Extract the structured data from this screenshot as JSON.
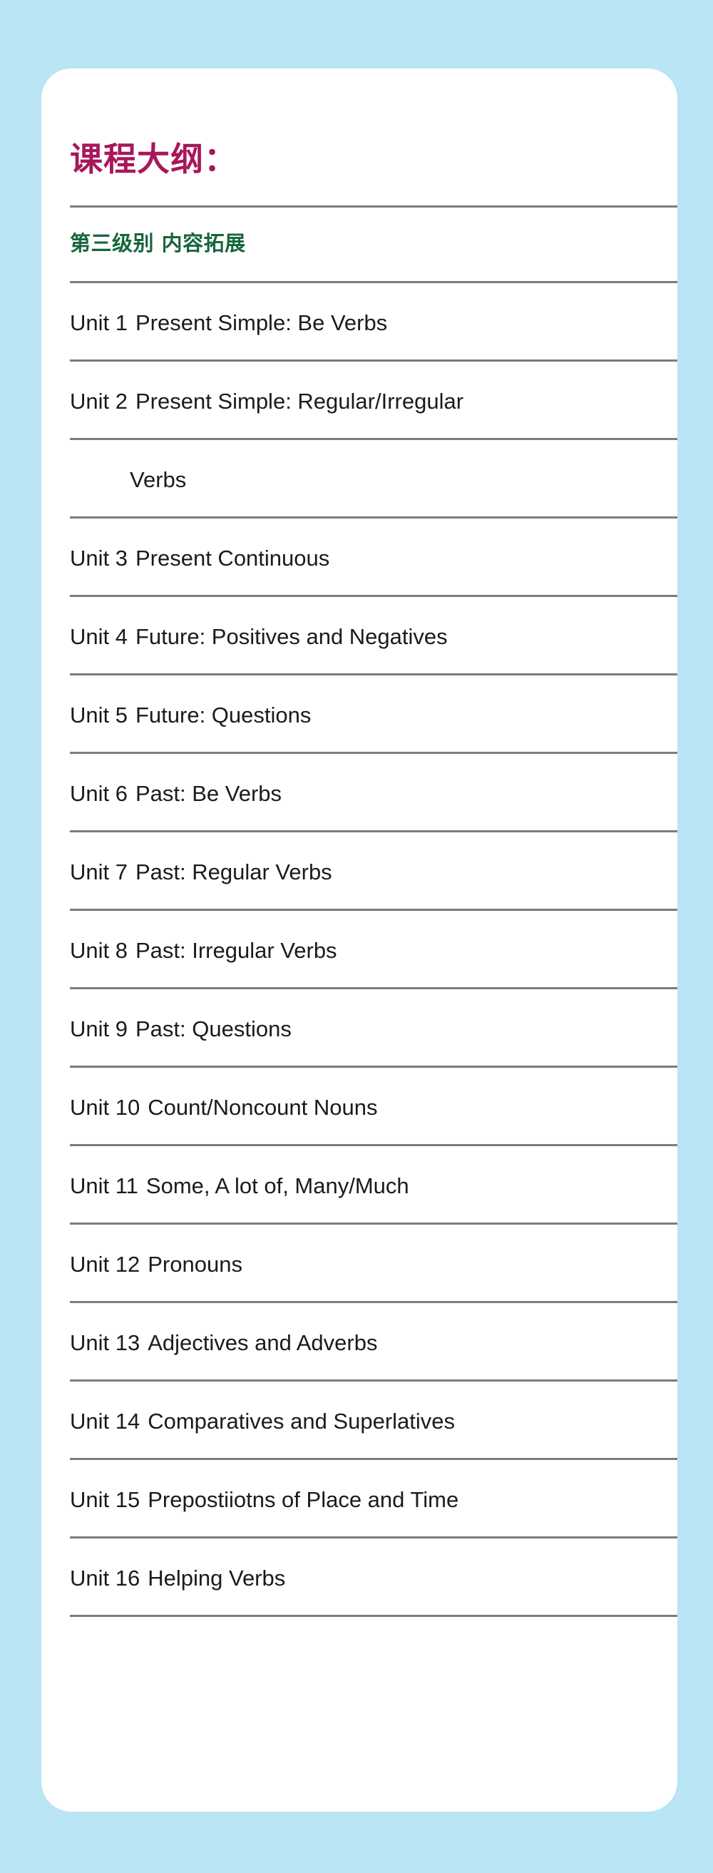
{
  "theme": {
    "background_color": "#b9e5f5",
    "card_color": "#ffffff",
    "title_color": "#a8175b",
    "subtitle_color": "#17663d",
    "text_color": "#1b1b1b",
    "divider_color": "#7c7c7c"
  },
  "card": {
    "title": "课程大纲：",
    "subtitle": "第三级别  内容拓展"
  },
  "units": [
    {
      "number": "Unit 1",
      "topic": "Present Simple: Be Verbs",
      "continuation": null
    },
    {
      "number": "Unit 2",
      "topic": "Present Simple: Regular/Irregular",
      "continuation": "Verbs"
    },
    {
      "number": "Unit 3",
      "topic": "Present Continuous",
      "continuation": null
    },
    {
      "number": "Unit 4",
      "topic": "Future: Positives and Negatives",
      "continuation": null
    },
    {
      "number": "Unit 5",
      "topic": "Future: Questions",
      "continuation": null
    },
    {
      "number": "Unit 6",
      "topic": "Past: Be Verbs",
      "continuation": null
    },
    {
      "number": "Unit 7",
      "topic": "Past: Regular Verbs",
      "continuation": null
    },
    {
      "number": "Unit 8",
      "topic": "Past: Irregular Verbs",
      "continuation": null
    },
    {
      "number": "Unit 9",
      "topic": "Past: Questions",
      "continuation": null
    },
    {
      "number": "Unit 10",
      "topic": "Count/Noncount Nouns",
      "continuation": null
    },
    {
      "number": "Unit 11",
      "topic": "Some, A lot of, Many/Much",
      "continuation": null
    },
    {
      "number": "Unit 12",
      "topic": "Pronouns",
      "continuation": null
    },
    {
      "number": "Unit 13",
      "topic": "Adjectives and Adverbs",
      "continuation": null
    },
    {
      "number": "Unit 14",
      "topic": "Comparatives and Superlatives",
      "continuation": null
    },
    {
      "number": "Unit 15",
      "topic": "Prepostiiotns of Place and Time",
      "continuation": null
    },
    {
      "number": "Unit 16",
      "topic": "Helping Verbs",
      "continuation": null
    }
  ]
}
